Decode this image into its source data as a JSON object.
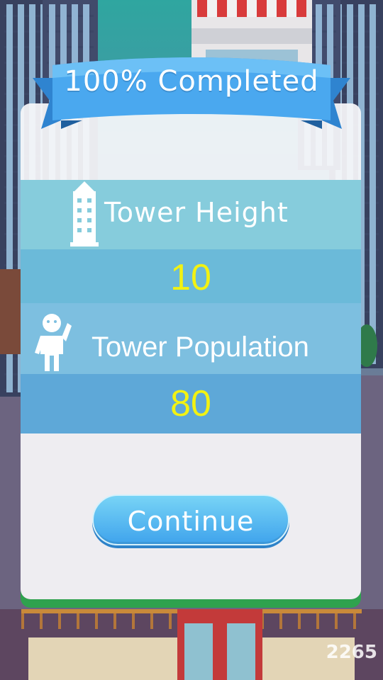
{
  "modal": {
    "title": "100% Completed",
    "rows": {
      "height_label": "Tower Height",
      "height_value": "10",
      "population_label": "Tower Population",
      "population_value": "80"
    },
    "continue_label": "Continue"
  },
  "watermark": "2265",
  "colors": {
    "ribbon": "#4aa8ef",
    "row_light": "#86ccdc",
    "row_dark": "#5ea8d8",
    "value_yellow": "#f2f212",
    "panel_edge_green": "#2fa24e",
    "button": "#3fa3ec"
  },
  "icons": {
    "height_icon": "building-icon",
    "population_icon": "person-waving-icon"
  }
}
